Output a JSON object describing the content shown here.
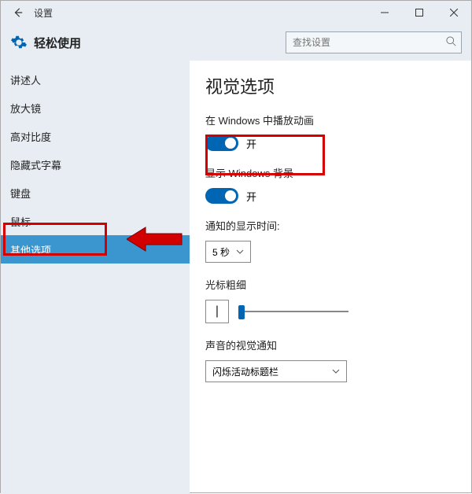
{
  "window": {
    "title": "设置"
  },
  "header": {
    "title": "轻松使用",
    "search_placeholder": "查找设置"
  },
  "sidebar": {
    "items": [
      {
        "label": "讲述人"
      },
      {
        "label": "放大镜"
      },
      {
        "label": "高对比度"
      },
      {
        "label": "隐藏式字幕"
      },
      {
        "label": "键盘"
      },
      {
        "label": "鼠标"
      },
      {
        "label": "其他选项"
      }
    ]
  },
  "page": {
    "title": "视觉选项",
    "anim_label": "在 Windows 中播放动画",
    "anim_state": "开",
    "bg_label": "显示 Windows 背景",
    "bg_state": "开",
    "notify_label": "通知的显示时间:",
    "notify_value": "5 秒",
    "cursor_label": "光标粗细",
    "cursor_char": "|",
    "sound_label": "声音的视觉通知",
    "sound_value": "闪烁活动标题栏"
  }
}
